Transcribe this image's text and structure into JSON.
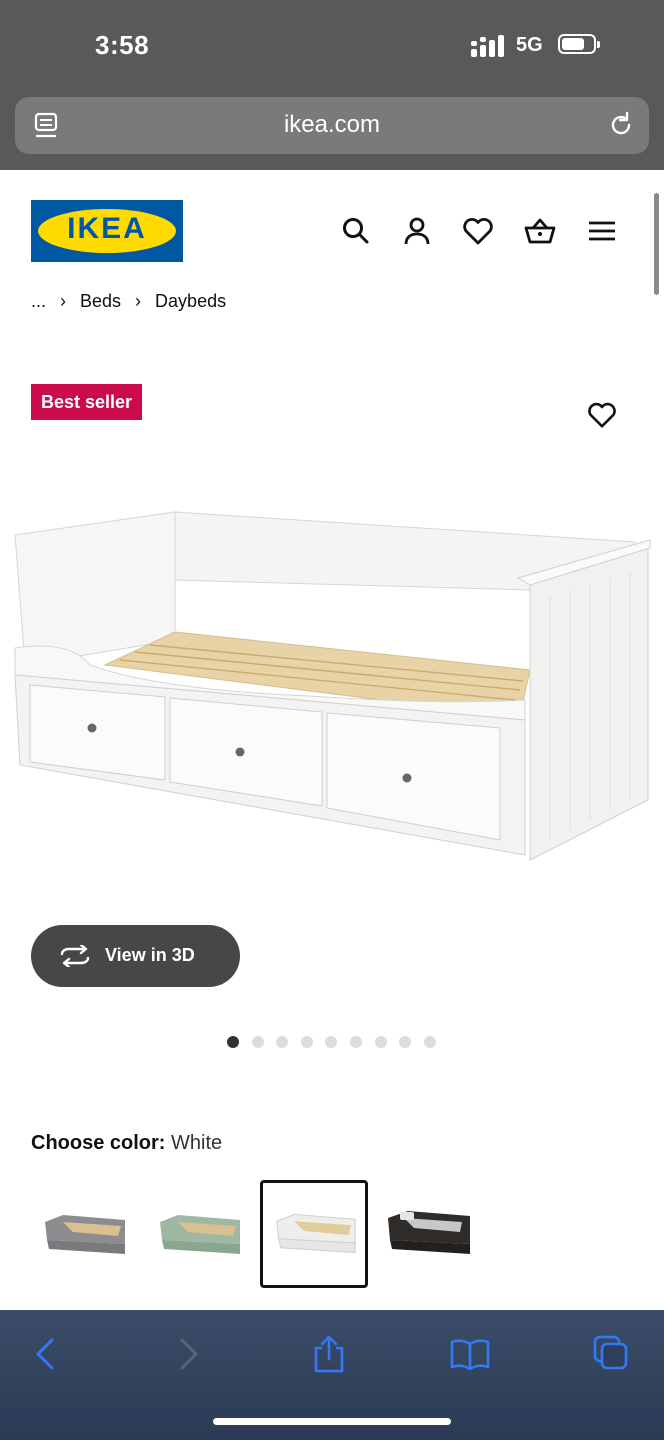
{
  "status": {
    "time": "3:58",
    "network": "5G"
  },
  "browser": {
    "url": "ikea.com"
  },
  "header": {
    "logo_text": "IKEA"
  },
  "breadcrumb": {
    "ellipsis": "...",
    "items": [
      "Beds",
      "Daybeds"
    ]
  },
  "product": {
    "badge": "Best seller",
    "view3d_label": "View in 3D",
    "gallery": {
      "total": 9,
      "active_index": 0
    }
  },
  "color_choice": {
    "label": "Choose color:",
    "value": "White",
    "swatches": [
      "gray",
      "green",
      "white",
      "black-brown"
    ],
    "selected": "white"
  },
  "colors": {
    "ikea_blue": "#0058a3",
    "ikea_yellow": "#ffdb00",
    "badge_red": "#cc0a4e",
    "ios_blue": "#3478f6"
  }
}
